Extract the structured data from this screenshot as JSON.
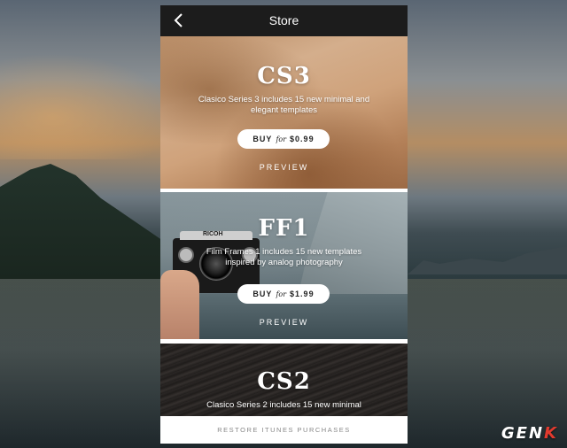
{
  "nav": {
    "title": "Store"
  },
  "products": [
    {
      "code": "CS3",
      "description": "Clasico Series 3 includes 15 new minimal and elegant templates",
      "buy_prefix": "BUY",
      "buy_for": "for",
      "price": "$0.99",
      "preview": "PREVIEW"
    },
    {
      "code": "FF1",
      "description": "Film Frames 1 includes 15 new templates inspired by analog photography",
      "buy_prefix": "BUY",
      "buy_for": "for",
      "price": "$1.99",
      "preview": "PREVIEW"
    },
    {
      "code": "CS2",
      "description": "Clasico Series 2 includes 15 new minimal"
    }
  ],
  "footer": {
    "restore": "RESTORE ITUNES PURCHASES"
  },
  "camera_label": "RICOH",
  "watermark": {
    "text_main": "GEN",
    "text_accent": "K"
  },
  "colors": {
    "navbar": "#1c1c1c",
    "watermark_accent": "#e23a2e"
  }
}
